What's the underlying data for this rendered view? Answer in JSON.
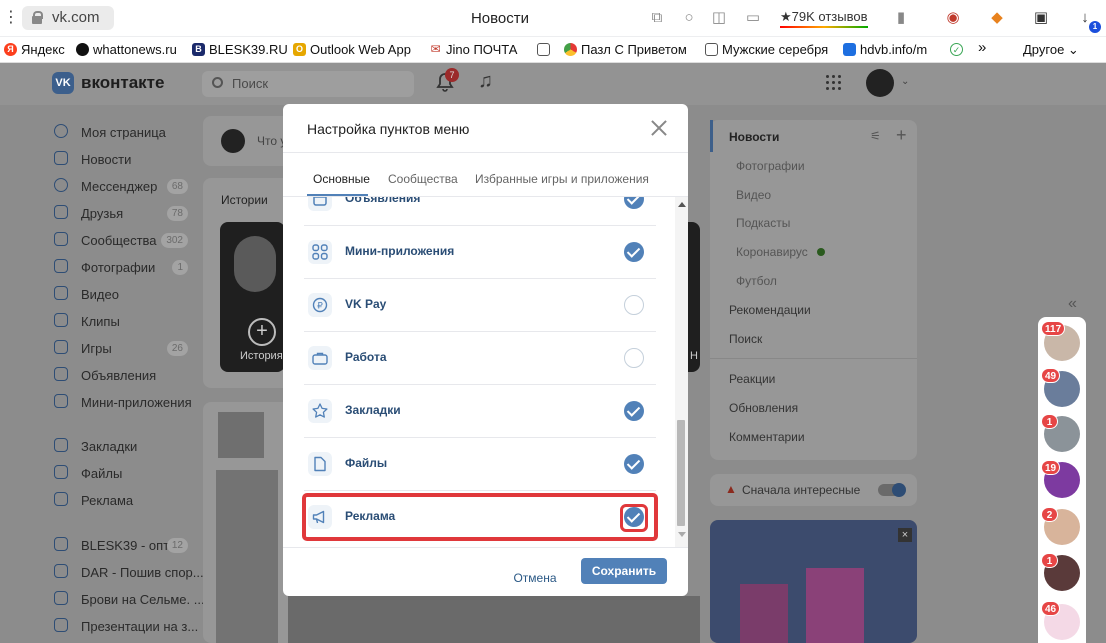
{
  "browser": {
    "url": "vk.com",
    "page_title": "Новости",
    "reviews": "★79K отзывов",
    "downloads_badge": "1",
    "bookmarks": [
      {
        "label": "Яндекс",
        "color": "#fc3f1d",
        "glyph": "Я"
      },
      {
        "label": "whattonews.ru",
        "color": "#111111",
        "glyph": ""
      },
      {
        "label": "BLESK39.RU",
        "color": "#1b2a6b",
        "glyph": "B"
      },
      {
        "label": "Outlook Web App",
        "color": "#e6a700",
        "glyph": "O"
      },
      {
        "label": "Jino ПОЧТА",
        "color": "#c0392b",
        "glyph": "✉"
      },
      {
        "label": "",
        "color": "#cccccc",
        "glyph": ""
      },
      {
        "label": "Пазл С Приветом",
        "color": "#e53935",
        "glyph": ""
      },
      {
        "label": "Мужские серебря",
        "color": "#cccccc",
        "glyph": ""
      },
      {
        "label": "hdvb.info/m",
        "color": "#1e6fe0",
        "glyph": ""
      },
      {
        "label": "",
        "color": "#3aa655",
        "glyph": "✓"
      }
    ],
    "more": "»",
    "other": "Другое"
  },
  "vk": {
    "logo": "VK",
    "brand": "вконтакте",
    "search_placeholder": "Поиск",
    "notif_count": "7",
    "left_nav": [
      {
        "label": "Моя страница",
        "count": ""
      },
      {
        "label": "Новости",
        "count": ""
      },
      {
        "label": "Мессенджер",
        "count": "68"
      },
      {
        "label": "Друзья",
        "count": "78"
      },
      {
        "label": "Сообщества",
        "count": "302"
      },
      {
        "label": "Фотографии",
        "count": "1"
      },
      {
        "label": "Видео",
        "count": ""
      },
      {
        "label": "Клипы",
        "count": ""
      },
      {
        "label": "Игры",
        "count": "26"
      },
      {
        "label": "Объявления",
        "count": ""
      },
      {
        "label": "Мини-приложения",
        "count": ""
      }
    ],
    "left_nav2": [
      {
        "label": "Закладки"
      },
      {
        "label": "Файлы"
      },
      {
        "label": "Реклама"
      }
    ],
    "left_groups": [
      {
        "label": "BLESK39 - опт...",
        "count": "12"
      },
      {
        "label": "DAR - Пошив спор...",
        "count": ""
      },
      {
        "label": "Брови на Сельме. ...",
        "count": ""
      },
      {
        "label": "Презентации на з...",
        "count": ""
      }
    ],
    "post_placeholder": "Что у",
    "stories_title": "Истории",
    "story_label": "История",
    "story_label2": "Н",
    "right_nav": {
      "main": "Новости",
      "subs": [
        "Фотографии",
        "Видео",
        "Подкасты",
        "Коронавирус",
        "Футбол"
      ],
      "items": [
        "Рекомендации",
        "Поиск"
      ],
      "items2": [
        "Реакции",
        "Обновления",
        "Комментарии"
      ]
    },
    "sort_label": "Сначала интересные",
    "friends_badges": [
      "117",
      "49",
      "1",
      "19",
      "2",
      "1",
      "46"
    ]
  },
  "dialog": {
    "title": "Настройка пунктов меню",
    "tabs": [
      "Основные",
      "Сообщества",
      "Избранные игры и приложения"
    ],
    "active_tab": 0,
    "rows": [
      {
        "label": "Объявления",
        "checked": true,
        "icon": "ads-icon"
      },
      {
        "label": "Мини-приложения",
        "checked": true,
        "icon": "apps-icon"
      },
      {
        "label": "VK Pay",
        "checked": false,
        "icon": "vkpay-icon"
      },
      {
        "label": "Работа",
        "checked": false,
        "icon": "briefcase-icon"
      },
      {
        "label": "Закладки",
        "checked": true,
        "icon": "star-icon"
      },
      {
        "label": "Файлы",
        "checked": true,
        "icon": "file-icon"
      },
      {
        "label": "Реклама",
        "checked": true,
        "icon": "megaphone-icon"
      }
    ],
    "cancel": "Отмена",
    "save": "Сохранить"
  }
}
